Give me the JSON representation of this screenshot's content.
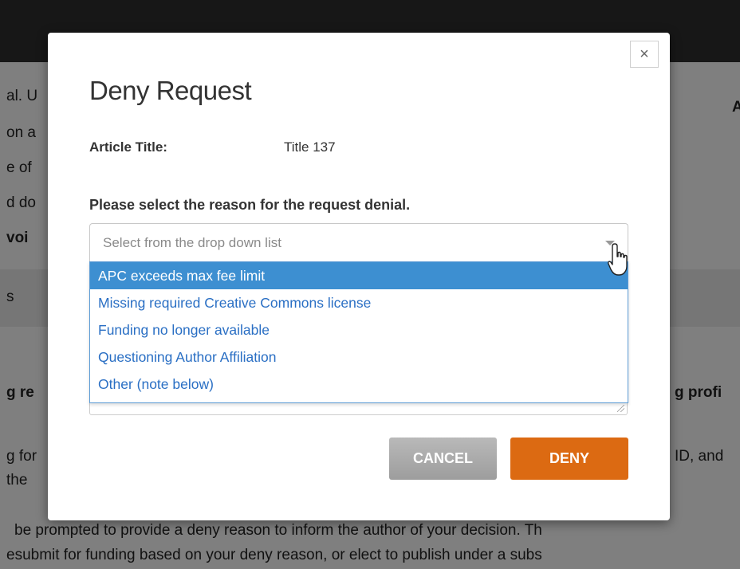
{
  "background": {
    "lines": [
      {
        "text": "al. U",
        "bold": false
      },
      {
        "text": "on a",
        "bold": false
      },
      {
        "text": "e of",
        "bold": false
      },
      {
        "text": "d do",
        "bold": false
      },
      {
        "text": "voi",
        "bold": true
      },
      {
        "text": "s",
        "bold": false
      },
      {
        "text": "g re",
        "bold": true
      },
      {
        "text": "g for",
        "bold": false
      },
      {
        "text": "the",
        "bold": false
      },
      {
        "text": "A",
        "bold": true
      },
      {
        "text": "g profi",
        "bold": true
      },
      {
        "text": "ID, and",
        "bold": false
      },
      {
        "text": "be prompted to provide a deny reason to inform the author of your decision. Th",
        "bold": false
      },
      {
        "text": "esubmit for funding based on your deny reason, or elect to publish under a subs",
        "bold": false
      }
    ]
  },
  "modal": {
    "title": "Deny Request",
    "close_icon": "close-icon",
    "article_label": "Article Title:",
    "article_value": "Title 137",
    "prompt": "Please select the reason for the request denial.",
    "select": {
      "placeholder": "Select from the drop down list",
      "options": [
        "APC exceeds max fee limit",
        "Missing required Creative Commons license",
        "Funding no longer available",
        "Questioning Author Affiliation",
        "Other (note below)"
      ],
      "highlighted_index": 0
    },
    "buttons": {
      "cancel": "CANCEL",
      "deny": "DENY"
    }
  },
  "colors": {
    "deny_button": "#dc6a12",
    "highlight": "#3d8fd1",
    "option_text": "#2a6fc4"
  },
  "cursor_icon": "hand-pointer-icon"
}
